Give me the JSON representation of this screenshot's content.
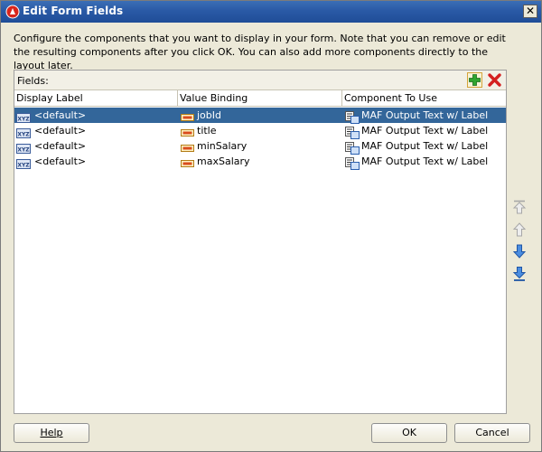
{
  "window": {
    "title": "Edit Form Fields",
    "close_label": "✕"
  },
  "description": "Configure the components that you want to display in your form.  Note that you can remove or edit the resulting components after you click OK.  You can also add more components directly to the layout later.",
  "fields": {
    "label": "Fields:",
    "columns": [
      "Display Label",
      "Value Binding",
      "Component To Use"
    ],
    "rows": [
      {
        "display_label": "<default>",
        "value_binding": "jobId",
        "component": "MAF Output Text w/ Label",
        "selected": true
      },
      {
        "display_label": "<default>",
        "value_binding": "title",
        "component": "MAF Output Text w/ Label",
        "selected": false
      },
      {
        "display_label": "<default>",
        "value_binding": "minSalary",
        "component": "MAF Output Text w/ Label",
        "selected": false
      },
      {
        "display_label": "<default>",
        "value_binding": "maxSalary",
        "component": "MAF Output Text w/ Label",
        "selected": false
      }
    ]
  },
  "buttons": {
    "help": "Help",
    "ok": "OK",
    "cancel": "Cancel"
  },
  "colors": {
    "selection": "#33669a",
    "title_bar": "#2a5aa6",
    "add": "#2fa52f",
    "delete": "#d42020",
    "move": "#2b6fc9"
  }
}
